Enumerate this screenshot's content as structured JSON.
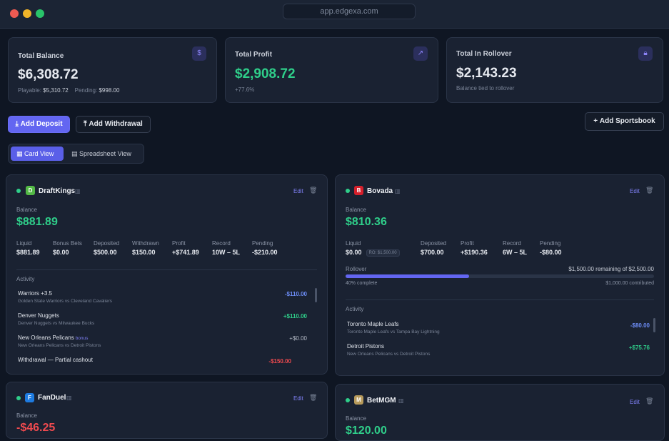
{
  "browser": {
    "url": "app.edgexa.com"
  },
  "stats": [
    {
      "label": "Total Balance",
      "value": "$6,308.72",
      "icon": "dollar-icon",
      "sub_playable_label": "Playable:",
      "sub_playable": "$5,310.72",
      "sub_pending_label": "Pending:",
      "sub_pending": "$998.00"
    },
    {
      "label": "Total Profit",
      "value": "$2,908.72",
      "icon": "trend-up-icon",
      "sub": "+77.6%"
    },
    {
      "label": "Total In Rollover",
      "value": "$2,143.23",
      "icon": "lock-icon",
      "sub": "Balance tied to rollover"
    }
  ],
  "actions": {
    "deposit": "Add Deposit",
    "withdrawal": "Add Withdrawal",
    "sportsbook": "Add Sportsbook"
  },
  "view_toggle": {
    "card": "Card View",
    "sheet": "Spreadsheet View",
    "active": "card"
  },
  "common": {
    "edit": "Edit",
    "balance": "Balance",
    "activity": "Activity",
    "liquid": "Liquid",
    "bonus_bets": "Bonus Bets",
    "deposited": "Deposited",
    "withdrawn": "Withdrawn",
    "profit": "Profit",
    "record": "Record",
    "pending": "Pending",
    "rollover": "Rollover"
  },
  "books": {
    "draftkings": {
      "name": "DraftKings",
      "balance": "$881.89",
      "liquid": "$881.89",
      "bonus_bets": "$0.00",
      "deposited": "$500.00",
      "withdrawn": "$150.00",
      "profit": "+$741.89",
      "record": "10W – 5L",
      "pending": "-$210.00",
      "activity": [
        {
          "title": "Warriors +3.5",
          "subtitle": "Golden State Warriors vs Cleveland Cavaliers",
          "amount": "-$110.00"
        },
        {
          "title": "Denver Nuggets",
          "subtitle": "Denver Nuggets vs Milwaukee Bucks",
          "amount": "+$110.00"
        },
        {
          "title": "New Orleans Pelicans",
          "tag": "bonus",
          "subtitle": "New Orleans Pelicans vs Detroit Pistons",
          "amount": "+$0.00"
        },
        {
          "title": "Withdrawal — Partial cashout",
          "subtitle": "",
          "amount": "-$150.00"
        }
      ]
    },
    "bovada": {
      "name": "Bovada",
      "balance": "$810.36",
      "liquid": "$0.00",
      "ro_tag": "RO: $1,500.00",
      "deposited": "$700.00",
      "profit": "+$190.36",
      "record": "6W – 5L",
      "pending": "-$80.00",
      "rollover_remaining": "$1,500.00 remaining of $2,500.00",
      "rollover_complete": "40% complete",
      "rollover_contributed": "$1,000.00 contributed",
      "rollover_progress": 0.4,
      "activity": [
        {
          "title": "Toronto Maple Leafs",
          "subtitle": "Toronto Maple Leafs vs Tampa Bay Lightning",
          "amount": "-$80.00"
        },
        {
          "title": "Detroit Pistons",
          "subtitle": "New Orleans Pelicans vs Detroit Pistons",
          "amount": "+$75.76"
        }
      ]
    },
    "fanduel": {
      "name": "FanDuel",
      "balance": "-$46.25"
    },
    "betmgm": {
      "name": "BetMGM",
      "balance": "$120.00"
    }
  },
  "colors": {
    "accent": "#6366f1",
    "positive": "#2fce8a",
    "negative": "#ef4a4f"
  }
}
